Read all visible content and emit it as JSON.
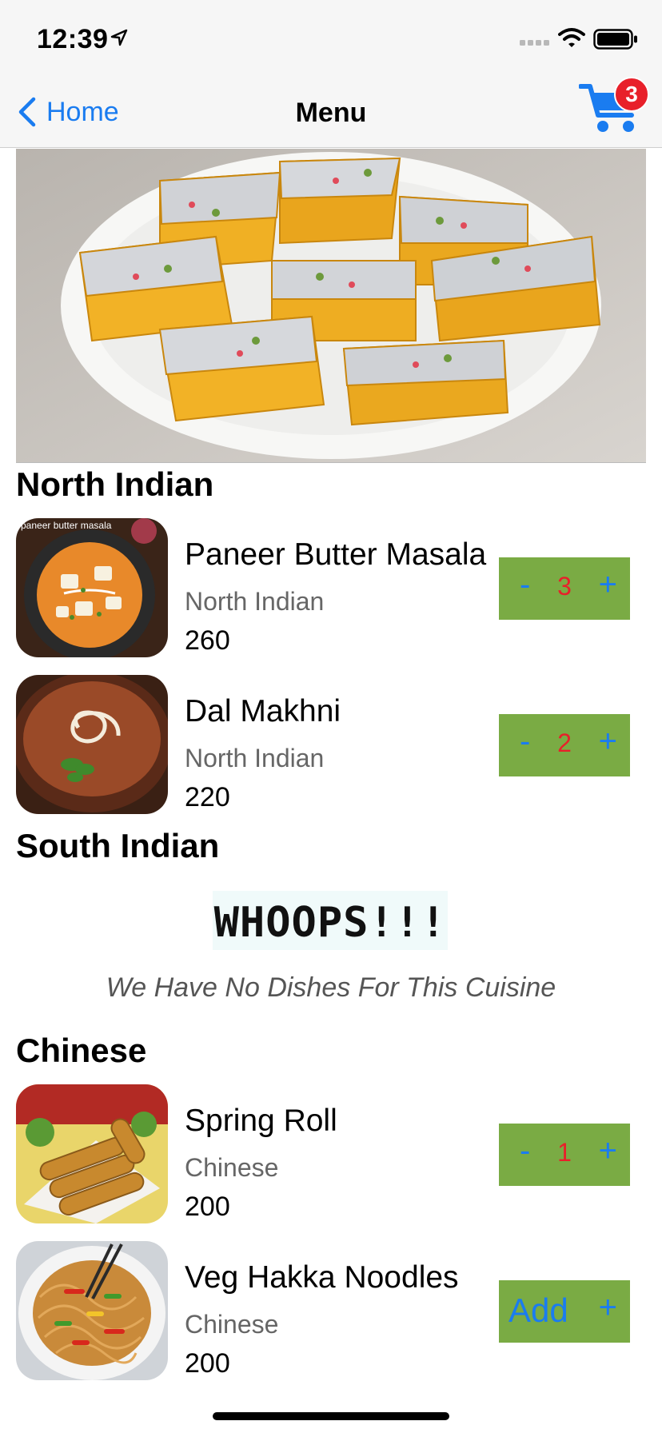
{
  "status_bar": {
    "time": "12:39"
  },
  "nav": {
    "back_label": "Home",
    "title": "Menu",
    "cart_count": "3"
  },
  "sections": [
    {
      "title": "North Indian",
      "dishes": [
        {
          "name": "Paneer Butter Masala",
          "cuisine": "North Indian",
          "price": "260",
          "qty": "3",
          "thumb_caption": "paneer butter masala"
        },
        {
          "name": "Dal Makhni",
          "cuisine": "North Indian",
          "price": "220",
          "qty": "2"
        }
      ]
    },
    {
      "title": "South Indian",
      "empty_title": "WHOOPS!!!",
      "empty_message": "We Have No Dishes For This Cuisine"
    },
    {
      "title": "Chinese",
      "dishes": [
        {
          "name": "Spring Roll",
          "cuisine": "Chinese",
          "price": "200",
          "qty": "1"
        },
        {
          "name": "Veg Hakka Noodles",
          "cuisine": "Chinese",
          "price": "200",
          "add_label": "Add"
        }
      ]
    }
  ],
  "stepper": {
    "minus": "-",
    "plus": "+"
  },
  "colors": {
    "accent": "#1a7cf0",
    "stepper_bg": "#7aab44",
    "qty": "#e8202a",
    "badge": "#e8202a"
  }
}
